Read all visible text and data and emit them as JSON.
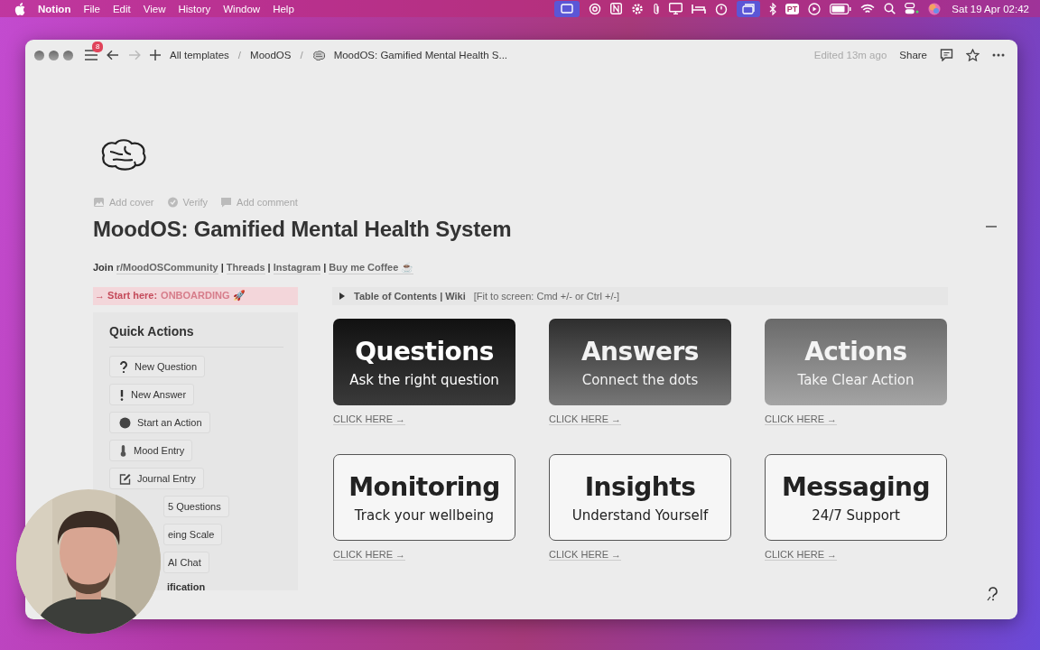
{
  "menu_bar": {
    "app": "Notion",
    "menus": [
      "File",
      "Edit",
      "View",
      "History",
      "Window",
      "Help"
    ],
    "input_badge": "PT",
    "clock": "Sat 19 Apr  02:42"
  },
  "toolbar": {
    "notification_count": "8",
    "breadcrumbs": [
      {
        "text": "All templates",
        "kind": "crumb"
      },
      {
        "text": "/",
        "kind": "separator"
      },
      {
        "text": "MoodOS",
        "kind": "crumb"
      },
      {
        "text": "/",
        "kind": "separator"
      },
      {
        "text": "MoodOS: Gamified Mental Health S...",
        "kind": "page"
      }
    ],
    "edited": "Edited 13m ago",
    "share": "Share"
  },
  "page": {
    "actions": [
      "Add cover",
      "Verify",
      "Add comment"
    ],
    "title": "MoodOS: Gamified Mental Health System",
    "links": [
      {
        "text": "Join",
        "kind": "plain"
      },
      {
        "text": "r/MoodOSCommunity",
        "kind": "link"
      },
      {
        "text": "|",
        "kind": "plain"
      },
      {
        "text": "Threads",
        "kind": "link"
      },
      {
        "text": "|",
        "kind": "plain"
      },
      {
        "text": "Instagram",
        "kind": "link"
      },
      {
        "text": "|",
        "kind": "plain"
      },
      {
        "text": "Buy me Coffee ☕",
        "kind": "link"
      }
    ],
    "callout": {
      "lead": "→ Start here:",
      "link": "ONBOARDING 🚀"
    },
    "toc": {
      "label": "Table of Contents | Wiki",
      "hint": "[Fit to screen: Cmd +/- or Ctrl +/-]",
      "expanded": false
    }
  },
  "quick_actions": {
    "title": "Quick Actions",
    "items": [
      {
        "label": "New Question",
        "kind": "question"
      },
      {
        "label": "New Answer",
        "kind": "exclaim"
      },
      {
        "label": "Start an Action",
        "kind": "dot"
      },
      {
        "label": "Mood Entry",
        "kind": "thermometer"
      },
      {
        "label": "Journal Entry",
        "kind": "edit"
      },
      {
        "label": "5 Questions",
        "kind": "covered"
      },
      {
        "label": "eing Scale",
        "kind": "covered"
      },
      {
        "label": "AI Chat",
        "kind": "covered"
      }
    ],
    "footer": "ification"
  },
  "cards": [
    {
      "title": "Questions",
      "subtitle": "Ask the right question",
      "kind": "dark",
      "link": "CLICK HERE →"
    },
    {
      "title": "Answers",
      "subtitle": "Connect the dots",
      "kind": "mid",
      "link": "CLICK HERE →"
    },
    {
      "title": "Actions",
      "subtitle": "Take Clear Action",
      "kind": "light",
      "link": "CLICK HERE →"
    },
    {
      "title": "Monitoring",
      "subtitle": "Track your wellbeing",
      "kind": "outline",
      "link": "CLICK HERE →"
    },
    {
      "title": "Insights",
      "subtitle": "Understand Yourself",
      "kind": "outline",
      "link": "CLICK HERE →"
    },
    {
      "title": "Messaging",
      "subtitle": "24/7 Support",
      "kind": "outline",
      "link": "CLICK HERE →"
    }
  ]
}
